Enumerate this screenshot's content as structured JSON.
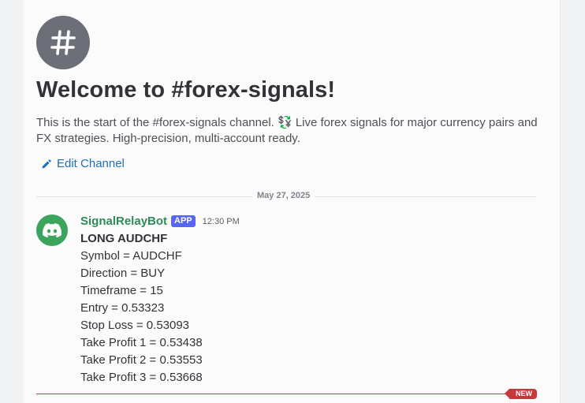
{
  "channel": {
    "welcome_title": "Welcome to #forex-signals!",
    "description": "This is the start of the #forex-signals channel. 💱 Live forex signals for major currency pairs and FX strategies. High-precision, multi-account ready.",
    "edit_label": "Edit Channel",
    "icon": "hashtag-icon"
  },
  "divider": {
    "date": "May 27, 2025"
  },
  "message": {
    "author": "SignalRelayBot",
    "badge": "APP",
    "timestamp": "12:30 PM",
    "avatar_icon": "discord-logo-icon",
    "lines": [
      "LONG AUDCHF",
      "Symbol = AUDCHF",
      "Direction = BUY",
      "Timeframe = 15",
      "Entry = 0.53323",
      "Stop Loss = 0.53093",
      "Take Profit 1 = 0.53438",
      "Take Profit 2 = 0.53553",
      "Take Profit 3 = 0.53668"
    ]
  },
  "new_marker": {
    "label": "NEW"
  },
  "colors": {
    "accent_link": "#1e6fbf",
    "author": "#2e8b57",
    "app_badge": "#5865f2",
    "avatar_bg": "#3ba55d",
    "new_marker": "#c8373a"
  }
}
